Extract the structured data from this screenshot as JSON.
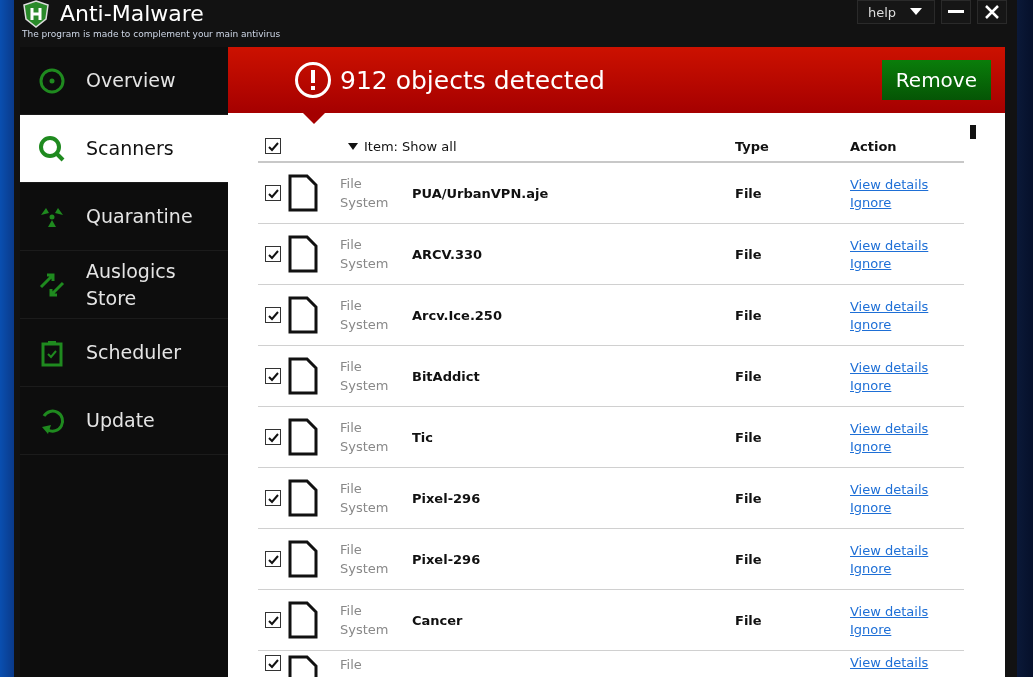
{
  "window": {
    "title": "Anti-Malware",
    "subtitle": "The program is made to complement your main antivirus",
    "help": "help"
  },
  "sidebar": {
    "items": [
      {
        "label": "Overview",
        "kind": "overview",
        "selected": false
      },
      {
        "label": "Scanners",
        "kind": "scanners",
        "selected": true
      },
      {
        "label": "Quarantine",
        "kind": "quarantine",
        "selected": false
      },
      {
        "label": "Auslogics Store",
        "kind": "store",
        "selected": false
      },
      {
        "label": "Scheduler",
        "kind": "scheduler",
        "selected": false
      },
      {
        "label": "Update",
        "kind": "update",
        "selected": false
      }
    ]
  },
  "banner": {
    "title": "912 objects detected",
    "button": "Remove"
  },
  "table": {
    "select_all_checked": true,
    "columns": [
      "Item: Show all",
      "Type",
      "Action"
    ],
    "rows": [
      {
        "checked": true,
        "source": "File System",
        "name": "PUA/UrbanVPN.aje",
        "type": "File",
        "actions": [
          "View details",
          "Ignore"
        ]
      },
      {
        "checked": true,
        "source": "File System",
        "name": "ARCV.330",
        "type": "File",
        "actions": [
          "View details",
          "Ignore"
        ]
      },
      {
        "checked": true,
        "source": "File System",
        "name": "Arcv.Ice.250",
        "type": "File",
        "actions": [
          "View details",
          "Ignore"
        ]
      },
      {
        "checked": true,
        "source": "File System",
        "name": "BitAddict",
        "type": "File",
        "actions": [
          "View details",
          "Ignore"
        ]
      },
      {
        "checked": true,
        "source": "File System",
        "name": "Tic",
        "type": "File",
        "actions": [
          "View details",
          "Ignore"
        ]
      },
      {
        "checked": true,
        "source": "File System",
        "name": "Pixel-296",
        "type": "File",
        "actions": [
          "View details",
          "Ignore"
        ]
      },
      {
        "checked": true,
        "source": "File System",
        "name": "Pixel-296",
        "type": "File",
        "actions": [
          "View details",
          "Ignore"
        ]
      },
      {
        "checked": true,
        "source": "File System",
        "name": "Cancer",
        "type": "File",
        "actions": [
          "View details",
          "Ignore"
        ]
      },
      {
        "checked": true,
        "source": "File",
        "actions": [
          "View details"
        ]
      }
    ]
  }
}
